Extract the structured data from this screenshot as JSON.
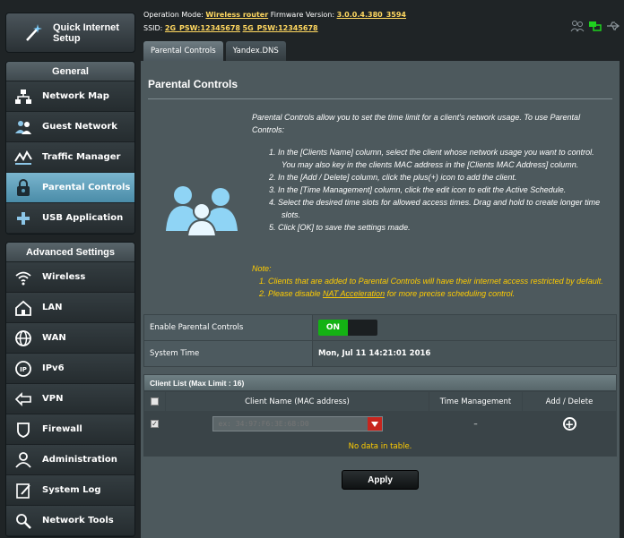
{
  "header": {
    "operation_mode_label": "Operation Mode:",
    "operation_mode_value": "Wireless router",
    "firmware_label": "Firmware Version:",
    "firmware_value": "3.0.0.4.380_3594",
    "ssid_label": "SSID:",
    "ssid_2g": "2G_PSW:12345678",
    "ssid_5g": "5G_PSW:12345678"
  },
  "sidebar": {
    "quick_setup": "Quick Internet Setup",
    "general_title": "General",
    "general_items": [
      {
        "label": "Network Map",
        "icon": "network-map-icon"
      },
      {
        "label": "Guest Network",
        "icon": "guest-network-icon"
      },
      {
        "label": "Traffic Manager",
        "icon": "traffic-manager-icon"
      },
      {
        "label": "Parental Controls",
        "icon": "parental-controls-icon",
        "active": true
      },
      {
        "label": "USB Application",
        "icon": "usb-application-icon"
      }
    ],
    "advanced_title": "Advanced Settings",
    "advanced_items": [
      {
        "label": "Wireless",
        "icon": "wireless-icon"
      },
      {
        "label": "LAN",
        "icon": "lan-icon"
      },
      {
        "label": "WAN",
        "icon": "wan-icon"
      },
      {
        "label": "IPv6",
        "icon": "ipv6-icon"
      },
      {
        "label": "VPN",
        "icon": "vpn-icon"
      },
      {
        "label": "Firewall",
        "icon": "firewall-icon"
      },
      {
        "label": "Administration",
        "icon": "administration-icon"
      },
      {
        "label": "System Log",
        "icon": "system-log-icon"
      },
      {
        "label": "Network Tools",
        "icon": "network-tools-icon"
      }
    ]
  },
  "tabs": [
    {
      "label": "Parental Controls",
      "active": true
    },
    {
      "label": "Yandex.DNS",
      "active": false
    }
  ],
  "main": {
    "title": "Parental Controls",
    "description": "Parental Controls allow you to set the time limit for a client's network usage. To use Parental Controls:",
    "steps": [
      "1. In the [Clients Name] column, select the client whose network usage you want to control. You may also key in the clients MAC address in the [Clients MAC Address] column.",
      "2. In the [Add / Delete] column, click the plus(+) icon to add the client.",
      "3. In the [Time Management] column, click the edit icon to edit the Active Schedule.",
      "4. Select the desired time slots for allowed access times. Drag and hold to create longer time slots.",
      "5. Click [OK] to save the settings made."
    ],
    "note_title": "Note:",
    "note_1": "1. Clients that are added to Parental Controls will have their internet access restricted by default.",
    "note_2_prefix": "2. Please disable ",
    "note_2_link": "NAT Acceleration",
    "note_2_suffix": " for more precise scheduling control.",
    "enable_label": "Enable Parental Controls",
    "enable_state": "ON",
    "system_time_label": "System Time",
    "system_time_value": "Mon, Jul 11 14:21:01 2016",
    "client_list_title": "Client List (Max Limit : 16)",
    "columns": [
      "Client Name (MAC address)",
      "Time Management",
      "Add / Delete"
    ],
    "mac_placeholder": "ex: 34:97:F6:3E:68:D0",
    "time_mgmt_value": "–",
    "no_data": "No data in table.",
    "apply_label": "Apply"
  },
  "colors": {
    "active_nav": "#5b9fbd",
    "toggle_on": "#14b214",
    "note": "#ffcc00",
    "select_button": "#c7251e"
  }
}
